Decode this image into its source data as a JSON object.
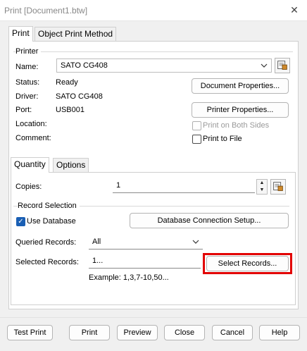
{
  "window": {
    "title": "Print [Document1.btw]",
    "close_glyph": "✕"
  },
  "tabs_top": [
    "Print",
    "Object Print Method"
  ],
  "printer": {
    "group_title": "Printer",
    "name_label": "Name:",
    "name_value": "SATO CG408",
    "status_label": "Status:",
    "status_value": "Ready",
    "driver_label": "Driver:",
    "driver_value": "SATO CG408",
    "port_label": "Port:",
    "port_value": "USB001",
    "location_label": "Location:",
    "comment_label": "Comment:",
    "document_properties": "Document Properties...",
    "printer_properties": "Printer Properties...",
    "print_both_sides": "Print on Both Sides",
    "print_to_file": "Print to File"
  },
  "tabs_inner": [
    "Quantity",
    "Options"
  ],
  "quantity": {
    "copies_label": "Copies:",
    "copies_value": "1",
    "record_selection_title": "Record Selection",
    "use_database": "Use Database",
    "database_connection_setup": "Database Connection Setup...",
    "queried_records_label": "Queried Records:",
    "queried_records_value": "All",
    "selected_records_label": "Selected Records:",
    "selected_records_value": "1...",
    "select_records": "Select Records...",
    "example": "Example: 1,3,7-10,50..."
  },
  "footer": {
    "test_print": "Test Print",
    "print": "Print",
    "preview": "Preview",
    "close": "Close",
    "cancel": "Cancel",
    "help": "Help"
  },
  "colors": {
    "highlight": "#e20000",
    "checkbox_on": "#1a5fb4"
  }
}
